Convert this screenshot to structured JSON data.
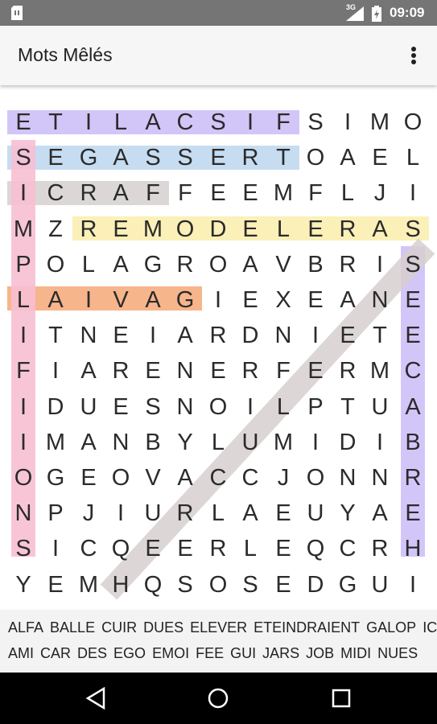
{
  "status_bar": {
    "network": "3G",
    "time": "09:09"
  },
  "app_bar": {
    "title": "Mots Mêlés",
    "menu_icon": "more-vert-icon"
  },
  "grid": {
    "rows": [
      [
        "E",
        "T",
        "I",
        "L",
        "A",
        "C",
        "S",
        "I",
        "F",
        "S",
        "I",
        "M",
        "O"
      ],
      [
        "S",
        "E",
        "G",
        "A",
        "S",
        "S",
        "E",
        "R",
        "T",
        "O",
        "A",
        "E",
        "L"
      ],
      [
        "I",
        "C",
        "R",
        "A",
        "F",
        "F",
        "E",
        "E",
        "M",
        "F",
        "L",
        "J",
        "I"
      ],
      [
        "M",
        "Z",
        "R",
        "E",
        "M",
        "O",
        "D",
        "E",
        "L",
        "E",
        "R",
        "A",
        "S"
      ],
      [
        "P",
        "O",
        "L",
        "A",
        "G",
        "R",
        "O",
        "A",
        "V",
        "B",
        "R",
        "I",
        "S"
      ],
      [
        "L",
        "A",
        "I",
        "V",
        "A",
        "G",
        "I",
        "E",
        "X",
        "E",
        "A",
        "N",
        "E"
      ],
      [
        "I",
        "T",
        "N",
        "E",
        "I",
        "A",
        "R",
        "D",
        "N",
        "I",
        "E",
        "T",
        "E"
      ],
      [
        "F",
        "I",
        "A",
        "R",
        "E",
        "N",
        "E",
        "R",
        "F",
        "E",
        "R",
        "M",
        "C"
      ],
      [
        "I",
        "D",
        "U",
        "E",
        "S",
        "N",
        "O",
        "I",
        "L",
        "P",
        "T",
        "U",
        "A"
      ],
      [
        "I",
        "M",
        "A",
        "N",
        "B",
        "Y",
        "L",
        "U",
        "M",
        "I",
        "D",
        "I",
        "B"
      ],
      [
        "O",
        "G",
        "E",
        "O",
        "V",
        "A",
        "C",
        "C",
        "J",
        "O",
        "N",
        "N",
        "R"
      ],
      [
        "N",
        "P",
        "J",
        "I",
        "U",
        "R",
        "L",
        "A",
        "E",
        "U",
        "Y",
        "A",
        "E"
      ],
      [
        "S",
        "I",
        "C",
        "Q",
        "E",
        "E",
        "R",
        "L",
        "E",
        "Q",
        "C",
        "R",
        "H"
      ],
      [
        "Y",
        "E",
        "M",
        "H",
        "Q",
        "S",
        "O",
        "S",
        "E",
        "D",
        "G",
        "U",
        "I"
      ]
    ]
  },
  "found_words": [
    {
      "word": "FISCALITE",
      "color": "#d2c6f9"
    },
    {
      "word": "TRESSAGES",
      "color": "#c6dcf1"
    },
    {
      "word": "FARCI",
      "color": "#dcd7d7"
    },
    {
      "word": "REMODELERAS",
      "color": "#fbf0b8"
    },
    {
      "word": "GAVIAL",
      "color": "#f7b58c"
    },
    {
      "word": "SIMPLIFIIONS",
      "color": "#f7bfd3"
    },
    {
      "word": "SEECABREH",
      "color": "#d2c6f9"
    },
    {
      "word": "diagonal",
      "color": "#d8cfcf"
    }
  ],
  "word_bank": {
    "row1": [
      "ALFA",
      "BALLE",
      "CUIR",
      "DUES",
      "ELEVER",
      "ETEINDRAIENT",
      "GALOP",
      "IC"
    ],
    "row2": [
      "AMI",
      "CAR",
      "DES",
      "EGO",
      "EMOI",
      "FEE",
      "GUI",
      "JARS",
      "JOB",
      "MIDI",
      "NUES"
    ]
  },
  "nav_bar": {
    "back": "back-icon",
    "home": "home-icon",
    "recents": "recents-icon"
  }
}
